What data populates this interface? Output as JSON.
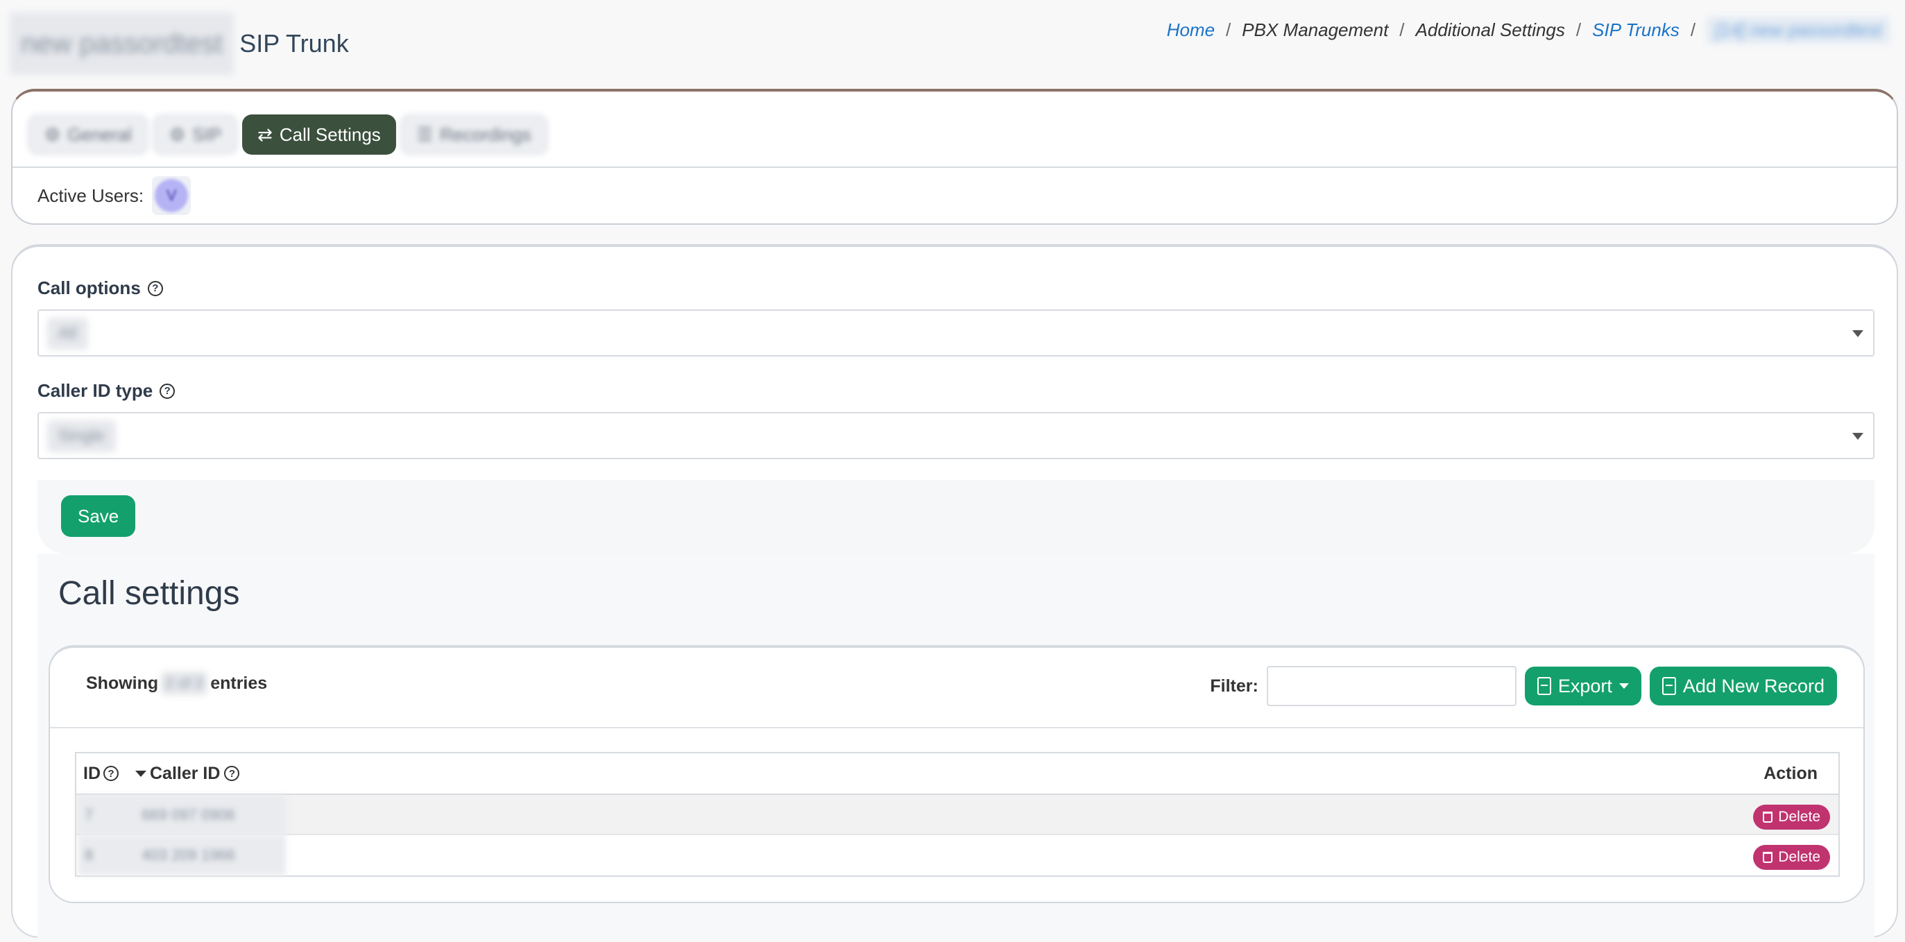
{
  "header": {
    "title_prefix": "new passordtest",
    "title_suffix": "SIP Trunk"
  },
  "breadcrumb": {
    "home": "Home",
    "pbx": "PBX Management",
    "additional": "Additional Settings",
    "sip_trunks": "SIP Trunks",
    "current": "[14] new passordtest",
    "separator": "/"
  },
  "tabs": {
    "general": "General",
    "sip": "SIP",
    "call_settings": "Call Settings",
    "recordings": "Recordings"
  },
  "active_users": {
    "label": "Active Users:",
    "avatar_initial": "V"
  },
  "form": {
    "call_options_label": "Call options",
    "call_options_value": "All",
    "caller_id_type_label": "Caller ID type",
    "caller_id_type_value": "Single",
    "save_label": "Save"
  },
  "section": {
    "title": "Call settings"
  },
  "table": {
    "showing_prefix": "Showing",
    "showing_count": "2 of 2",
    "showing_suffix": "entries",
    "filter_label": "Filter:",
    "export_label": "Export",
    "add_label": "Add New Record",
    "columns": {
      "id": "ID",
      "caller_id": "Caller ID",
      "action": "Action"
    },
    "rows": [
      {
        "id": "7",
        "caller_id": "669 097 0906",
        "action": "Delete"
      },
      {
        "id": "8",
        "caller_id": "403 209 1966",
        "action": "Delete"
      }
    ]
  },
  "colors": {
    "active_tab": "#3b503d",
    "primary_green": "#13a06c",
    "delete_red": "#c0336f",
    "link_blue": "#1a73c8"
  }
}
